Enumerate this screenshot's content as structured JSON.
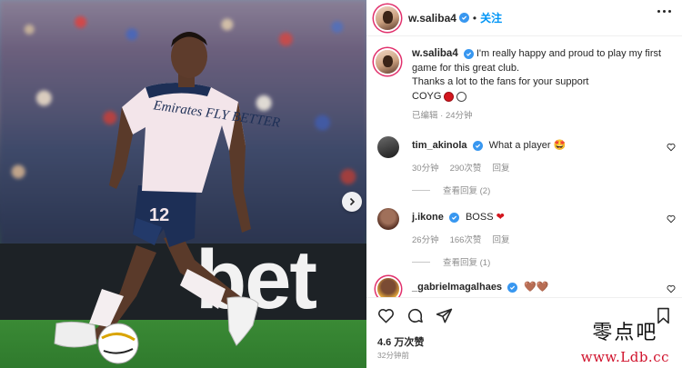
{
  "header": {
    "username": "w.saliba4",
    "separator": "•",
    "follow_label": "关注"
  },
  "caption": {
    "username": "w.saliba4",
    "line1": "I'm really happy and proud to play my first game for this great club.",
    "line2": "Thanks a lot to the fans for your support",
    "line3": "COYG",
    "edited_label": "已编辑",
    "time": "24分钟",
    "emoji_colors": [
      "#d3161e",
      "#ffffff"
    ]
  },
  "comments": [
    {
      "username": "tim_akinola",
      "text": "What a player",
      "emoji": "🤩",
      "time": "30分钟",
      "likes": "290次赞",
      "reply_label": "回复",
      "view_replies": "查看回复 (2)"
    },
    {
      "username": "j.ikone",
      "text": "BOSS",
      "emoji": "❤",
      "time": "26分钟",
      "likes": "166次赞",
      "reply_label": "回复",
      "view_replies": "查看回复 (1)"
    },
    {
      "username": "_gabrielmagalhaes",
      "text": "",
      "emoji": "🤎🤎"
    }
  ],
  "photo": {
    "board_text": "bet",
    "shirt_sponsor": "Emirates FLY BETTER",
    "shirt_number": "12"
  },
  "actions": {
    "likes": "4.6 万次赞",
    "posted": "32分钟前"
  },
  "watermark": {
    "site_cn": "零点吧",
    "site_url": "www.Ldb.cc"
  },
  "icons": [
    "heart-icon",
    "comment-icon",
    "share-icon",
    "bookmark-icon",
    "more-icon",
    "verified-icon",
    "chevron-right-icon"
  ]
}
